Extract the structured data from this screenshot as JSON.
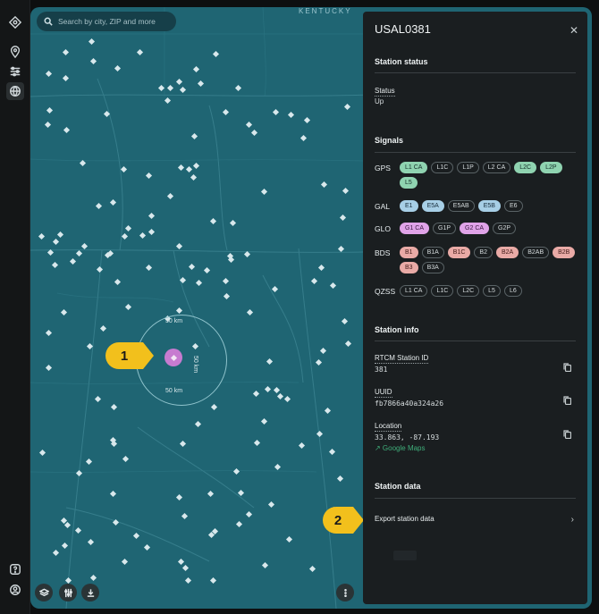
{
  "map": {
    "state_label": "KENTUCKY",
    "search_placeholder": "Search by city, ZIP and more",
    "radius_top": "50 km",
    "radius_bottom": "50 km",
    "radius_side": "50 km"
  },
  "callouts": {
    "one": "1",
    "two": "2"
  },
  "panel": {
    "title": "USAL0381",
    "status_section": "Station status",
    "status_label": "Status",
    "status_value": "Up",
    "signals_section": "Signals",
    "signals": [
      {
        "name": "GPS",
        "chips": [
          {
            "label": "L1 CA",
            "style": "green"
          },
          {
            "label": "L1C",
            "style": "outline"
          },
          {
            "label": "L1P",
            "style": "outline"
          },
          {
            "label": "L2 CA",
            "style": "outline"
          },
          {
            "label": "L2C",
            "style": "green"
          },
          {
            "label": "L2P",
            "style": "green"
          },
          {
            "label": "L5",
            "style": "green"
          }
        ]
      },
      {
        "name": "GAL",
        "chips": [
          {
            "label": "E1",
            "style": "blue"
          },
          {
            "label": "E5A",
            "style": "blue"
          },
          {
            "label": "E5AB",
            "style": "outline"
          },
          {
            "label": "E5B",
            "style": "blue"
          },
          {
            "label": "E6",
            "style": "outline"
          }
        ]
      },
      {
        "name": "GLO",
        "chips": [
          {
            "label": "G1 CA",
            "style": "pink"
          },
          {
            "label": "G1P",
            "style": "outline"
          },
          {
            "label": "G2 CA",
            "style": "pink"
          },
          {
            "label": "G2P",
            "style": "outline"
          }
        ]
      },
      {
        "name": "BDS",
        "chips": [
          {
            "label": "B1",
            "style": "salmon"
          },
          {
            "label": "B1A",
            "style": "outline"
          },
          {
            "label": "B1C",
            "style": "salmon"
          },
          {
            "label": "B2",
            "style": "outline"
          },
          {
            "label": "B2A",
            "style": "salmon"
          },
          {
            "label": "B2AB",
            "style": "outline"
          },
          {
            "label": "B2B",
            "style": "salmon"
          },
          {
            "label": "B3",
            "style": "salmon"
          },
          {
            "label": "B3A",
            "style": "outline"
          }
        ]
      },
      {
        "name": "QZSS",
        "chips": [
          {
            "label": "L1 CA",
            "style": "outline"
          },
          {
            "label": "L1C",
            "style": "outline"
          },
          {
            "label": "L2C",
            "style": "outline"
          },
          {
            "label": "L5",
            "style": "outline"
          },
          {
            "label": "L6",
            "style": "outline"
          }
        ]
      }
    ],
    "info_section": "Station info",
    "rtcm_label": "RTCM Station ID",
    "rtcm_value": "381",
    "uuid_label": "UUID",
    "uuid_value": "fb7866a40a324a26",
    "location_label": "Location",
    "location_value": "33.863, -87.193",
    "google_maps": "↗ Google Maps",
    "data_section": "Station data",
    "export_label": "Export station data"
  },
  "colors": {
    "map_water": "#1f6573",
    "panel_bg": "#1a1e20",
    "callout": "#f2c01c",
    "selected_station": "#c77bd0",
    "link_green": "#3fae7a"
  }
}
